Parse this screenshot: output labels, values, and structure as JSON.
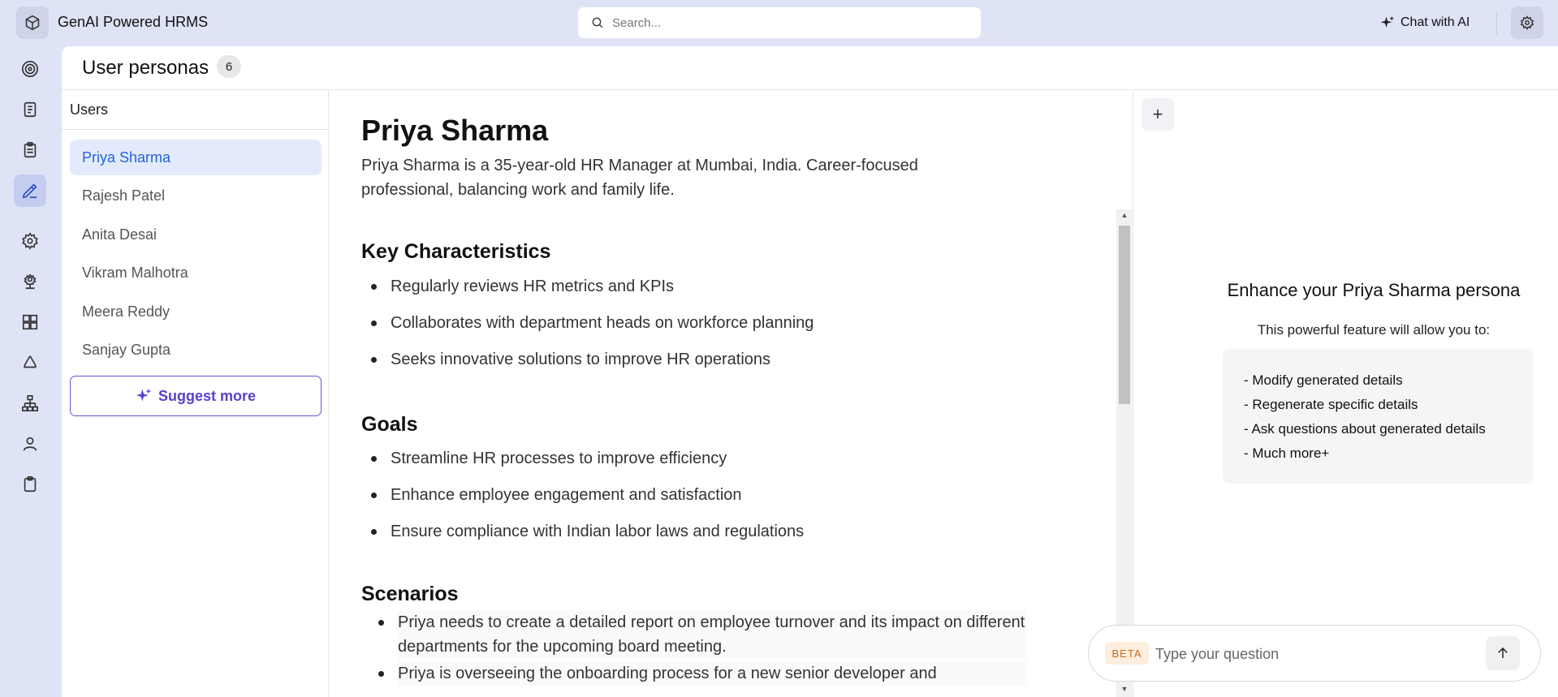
{
  "app": {
    "title": "GenAI Powered HRMS"
  },
  "search": {
    "placeholder": "Search..."
  },
  "header": {
    "chat_label": "Chat with AI"
  },
  "rail": {
    "items": [
      "target-icon",
      "document-icon",
      "clipboard-list-icon",
      "pen-tool-icon",
      "gear-icon",
      "settings-network-icon",
      "dashboard-icon",
      "recycle-icon",
      "org-chart-icon",
      "user-icon",
      "clipboard-icon"
    ],
    "active_index": 3
  },
  "page": {
    "title": "User personas",
    "count": "6"
  },
  "users": {
    "heading": "Users",
    "items": [
      "Priya Sharma",
      "Rajesh Patel",
      "Anita Desai",
      "Vikram Malhotra",
      "Meera Reddy",
      "Sanjay Gupta"
    ],
    "selected": "Priya Sharma",
    "suggest_label": "Suggest more"
  },
  "persona": {
    "name": "Priya Sharma",
    "description": "Priya Sharma is a 35-year-old HR Manager at Mumbai, India. Career-focused professional, balancing work and family life.",
    "sections": {
      "characteristics": {
        "title": "Key Characteristics",
        "items": [
          "Regularly reviews HR metrics and KPIs",
          "Collaborates with department heads on workforce planning",
          "Seeks innovative solutions to improve HR operations"
        ]
      },
      "goals": {
        "title": "Goals",
        "items": [
          "Streamline HR processes to improve efficiency",
          "Enhance employee engagement and satisfaction",
          "Ensure compliance with Indian labor laws and regulations"
        ]
      },
      "scenarios": {
        "title": "Scenarios",
        "items": [
          "Priya needs to create a detailed report on employee turnover and its impact on different departments for the upcoming board meeting.",
          "Priya is overseeing the onboarding process for a new senior developer and"
        ]
      }
    }
  },
  "enhance": {
    "title": "Enhance your Priya Sharma persona",
    "subtitle": "This powerful feature will allow you to:",
    "items": [
      "- Modify generated details",
      "- Regenerate specific details",
      "- Ask questions about generated details",
      "- Much more+"
    ]
  },
  "chat": {
    "badge": "BETA",
    "placeholder": "Type your question"
  },
  "colors": {
    "accent": "#5a40cf",
    "selected": "#2563d9",
    "rail_bg": "#dfe3f6"
  }
}
